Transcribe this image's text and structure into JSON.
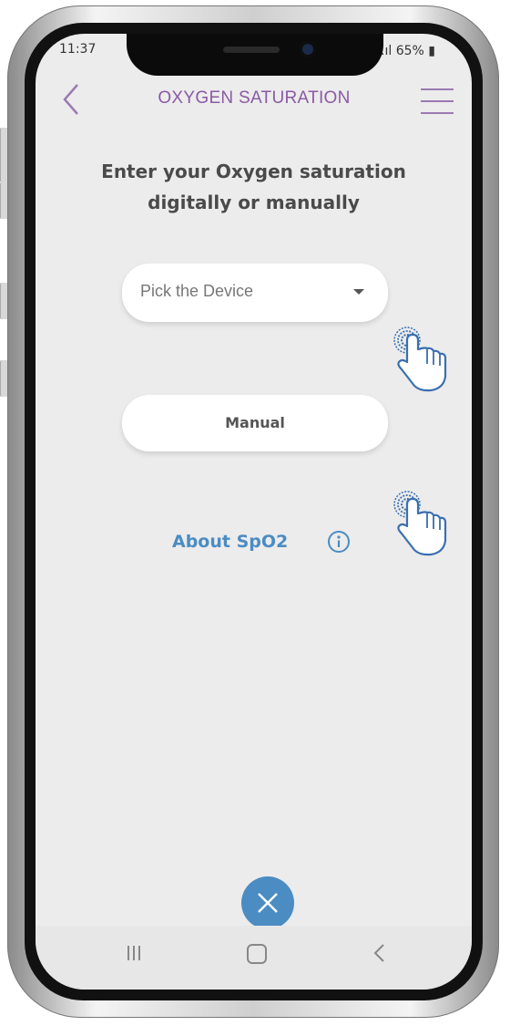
{
  "status_bar": {
    "time": "11:37",
    "battery": "65%"
  },
  "header": {
    "title": "OXYGEN SATURATION",
    "back_icon": "chevron-left-icon",
    "menu_icon": "hamburger-menu-icon"
  },
  "main": {
    "heading_line1": "Enter your Oxygen saturation",
    "heading_line2": "digitally or manually",
    "device_select": {
      "value": "Pick the Device",
      "icon": "dropdown-caret-icon"
    },
    "manual_button": "Manual",
    "about_link": "About SpO2",
    "info_icon": "info-icon",
    "tap_hint_icon": "tap-hand-icon"
  },
  "footer": {
    "close_icon": "close-x-icon"
  },
  "nav_bar": {
    "recents_icon": "recents-icon",
    "home_icon": "home-icon",
    "back_icon": "back-icon"
  },
  "colors": {
    "title": "#8a5aa3",
    "accent_blue": "#4b8cc3",
    "background": "#ececec",
    "heading": "#4a4a4a"
  }
}
